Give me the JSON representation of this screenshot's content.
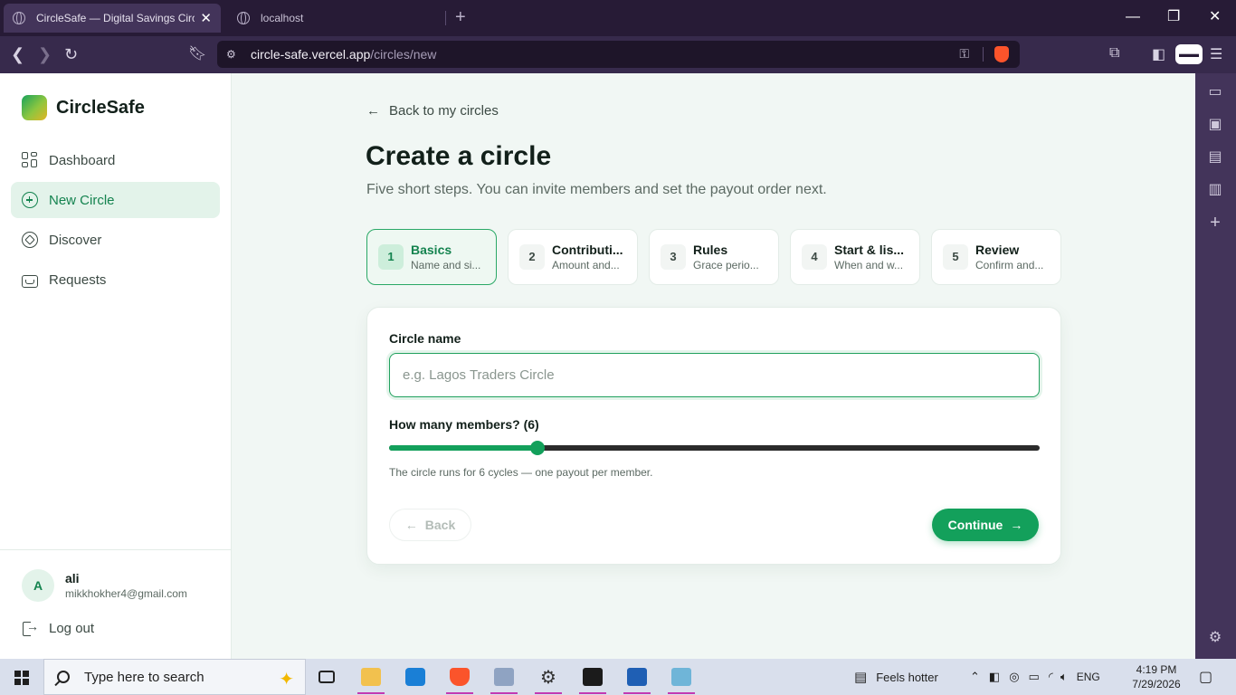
{
  "browser": {
    "tabs": [
      {
        "title": "CircleSafe — Digital Savings Circle",
        "active": true
      },
      {
        "title": "localhost",
        "active": false
      }
    ],
    "url_host": "circle-safe.vercel.app",
    "url_path": "/circles/new"
  },
  "sidebar": {
    "brand": "CircleSafe",
    "nav": [
      {
        "label": "Dashboard",
        "icon": "grid-icon",
        "active": false
      },
      {
        "label": "New Circle",
        "icon": "plus-circle-icon",
        "active": true
      },
      {
        "label": "Discover",
        "icon": "compass-icon",
        "active": false
      },
      {
        "label": "Requests",
        "icon": "inbox-icon",
        "active": false
      }
    ],
    "user": {
      "initial": "A",
      "name": "ali",
      "email": "mikkhokher4@gmail.com"
    },
    "logout_label": "Log out"
  },
  "main": {
    "back_link": "Back to my circles",
    "title": "Create a circle",
    "subtitle": "Five short steps. You can invite members and set the payout order next.",
    "steps": [
      {
        "num": "1",
        "label": "Basics",
        "desc": "Name and si...",
        "active": true
      },
      {
        "num": "2",
        "label": "Contributi...",
        "desc": "Amount and...",
        "active": false
      },
      {
        "num": "3",
        "label": "Rules",
        "desc": "Grace perio...",
        "active": false
      },
      {
        "num": "4",
        "label": "Start & lis...",
        "desc": "When and w...",
        "active": false
      },
      {
        "num": "5",
        "label": "Review",
        "desc": "Confirm and...",
        "active": false
      }
    ],
    "form": {
      "name_label": "Circle name",
      "name_value": "",
      "name_placeholder": "e.g. Lagos Traders Circle",
      "members_label": "How many members? (6)",
      "members_value": 6,
      "members_fraction": 0.228,
      "hint": "The circle runs for 6 cycles — one payout per member.",
      "back_label": "Back",
      "continue_label": "Continue"
    }
  },
  "taskbar": {
    "search_placeholder": "Type here to search",
    "weather": "Feels hotter",
    "language": "ENG",
    "time": "4:19 PM",
    "date": "7/29/2026"
  },
  "colors": {
    "accent": "#13a05b",
    "accent_soft": "#e3f3ea",
    "browser_chrome": "#271b36"
  }
}
